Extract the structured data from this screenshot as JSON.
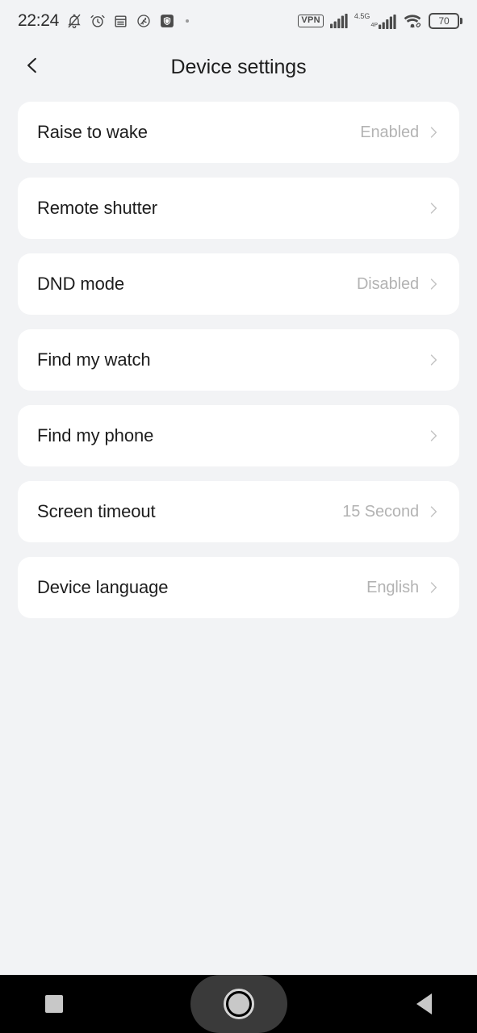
{
  "status_bar": {
    "time": "22:24",
    "left_icons": [
      {
        "name": "bell-muted-icon"
      },
      {
        "name": "alarm-clock-icon"
      },
      {
        "name": "notes-icon"
      },
      {
        "name": "fitness-run-icon"
      },
      {
        "name": "shield-icon"
      },
      {
        "name": "dot-indicator-icon"
      }
    ],
    "vpn_label": "VPN",
    "network_label": "4.5G",
    "network_sub_label": "4P",
    "wifi_icon": "wifi-icon",
    "battery_level": "70"
  },
  "header": {
    "back_icon": "chevron-left-icon",
    "title": "Device settings"
  },
  "settings": {
    "rows": [
      {
        "label": "Raise to wake",
        "value": "Enabled"
      },
      {
        "label": "Remote shutter",
        "value": ""
      },
      {
        "label": "DND mode",
        "value": "Disabled"
      },
      {
        "label": "Find my watch",
        "value": ""
      },
      {
        "label": "Find my phone",
        "value": ""
      },
      {
        "label": "Screen timeout",
        "value": "15 Second"
      },
      {
        "label": "Device language",
        "value": "English"
      }
    ]
  },
  "nav_bar": {
    "recents_label": "recents-button",
    "home_label": "home-button",
    "back_label": "back-button"
  },
  "colors": {
    "page_background": "#f2f3f5",
    "card_background": "#ffffff",
    "primary_text": "#1d1d1d",
    "secondary_text": "#b3b3b3",
    "nav_background": "#000000"
  }
}
